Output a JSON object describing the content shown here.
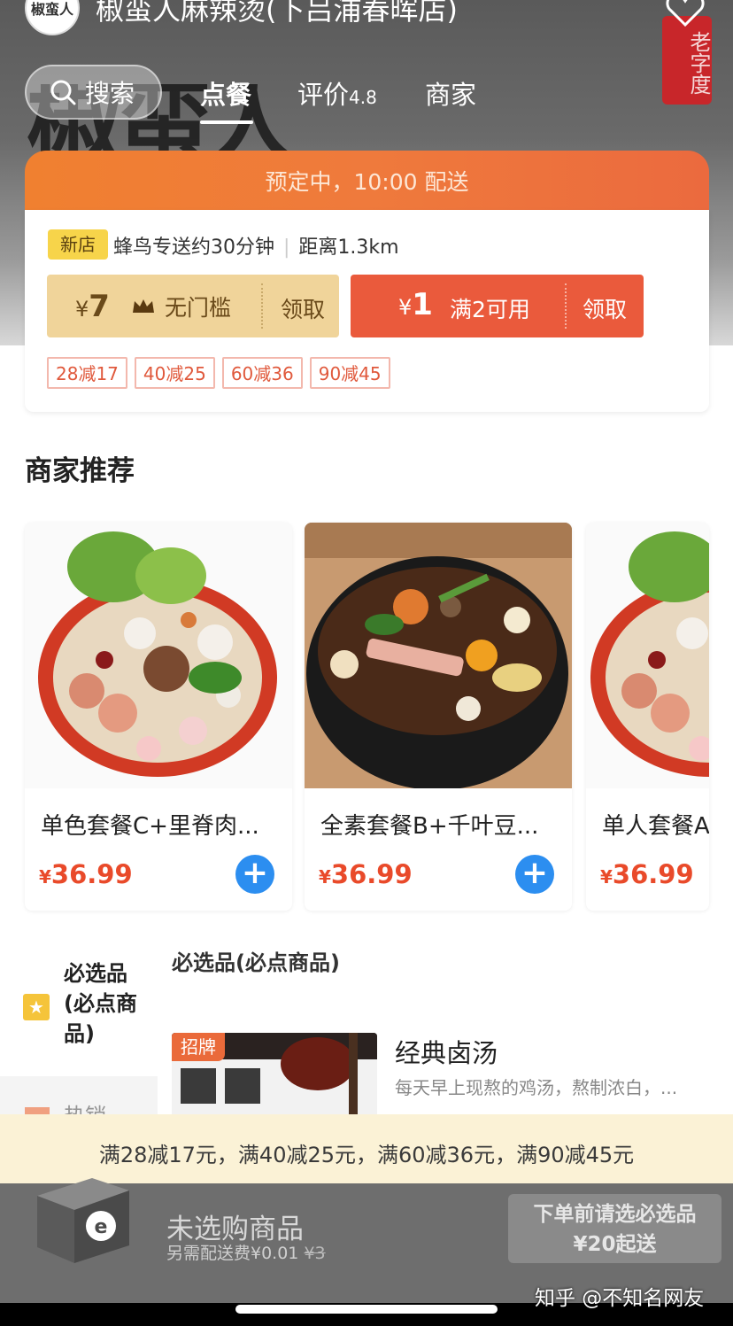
{
  "header": {
    "shop_name": "椒蛮人麻辣烫(下吕浦春晖店)",
    "logo_text": "椒蛮人",
    "seal_text": "老字度",
    "search_label": "搜索",
    "tabs": [
      {
        "label": "点餐",
        "active": true
      },
      {
        "label": "评价",
        "score": "4.8"
      },
      {
        "label": "商家"
      }
    ]
  },
  "promo": {
    "preorder_text": "预定中，10:00 配送",
    "new_badge": "新店",
    "delivery_text": "蜂鸟专送约30分钟",
    "distance_text": "距离1.3km",
    "coupon_gold": {
      "currency": "¥",
      "amount": "7",
      "condition": "无门槛",
      "action": "领取"
    },
    "coupon_red": {
      "currency": "¥",
      "amount": "1",
      "condition": "满2可用",
      "action": "领取"
    },
    "discount_tags": [
      "28减17",
      "40减25",
      "60减36",
      "90减45"
    ]
  },
  "recommend": {
    "title": "商家推荐",
    "items": [
      {
        "name": "单色套餐C+里脊肉...",
        "price": "36.99",
        "currency": "¥"
      },
      {
        "name": "全素套餐B+千叶豆...",
        "price": "36.99",
        "currency": "¥"
      },
      {
        "name": "单人套餐A",
        "price": "36.99",
        "currency": "¥"
      }
    ]
  },
  "categories": {
    "active": "必选品(必点商品)",
    "next": "热销"
  },
  "list": {
    "header": "必选品(必点商品)",
    "dish": {
      "badge": "招牌",
      "name": "经典卤汤",
      "desc": "每天早上现熬的鸡汤，熬制浓白，..."
    }
  },
  "bottom": {
    "promo_strip": "满28减17元，满40减25元，满60减36元，满90减45元",
    "cart_empty": "未选购商品",
    "fee_text": "另需配送费¥0.01",
    "fee_original": "¥3",
    "checkout_line1": "下单前请选必选品",
    "checkout_line2": "¥20起送"
  },
  "watermark": "知乎 @不知名网友",
  "colors": {
    "accent_orange": "#ef7a3c",
    "price_red": "#e94a2a",
    "add_blue": "#2c8ef0",
    "coupon_gold": "#f0d49a",
    "coupon_red": "#ea5a3c"
  }
}
